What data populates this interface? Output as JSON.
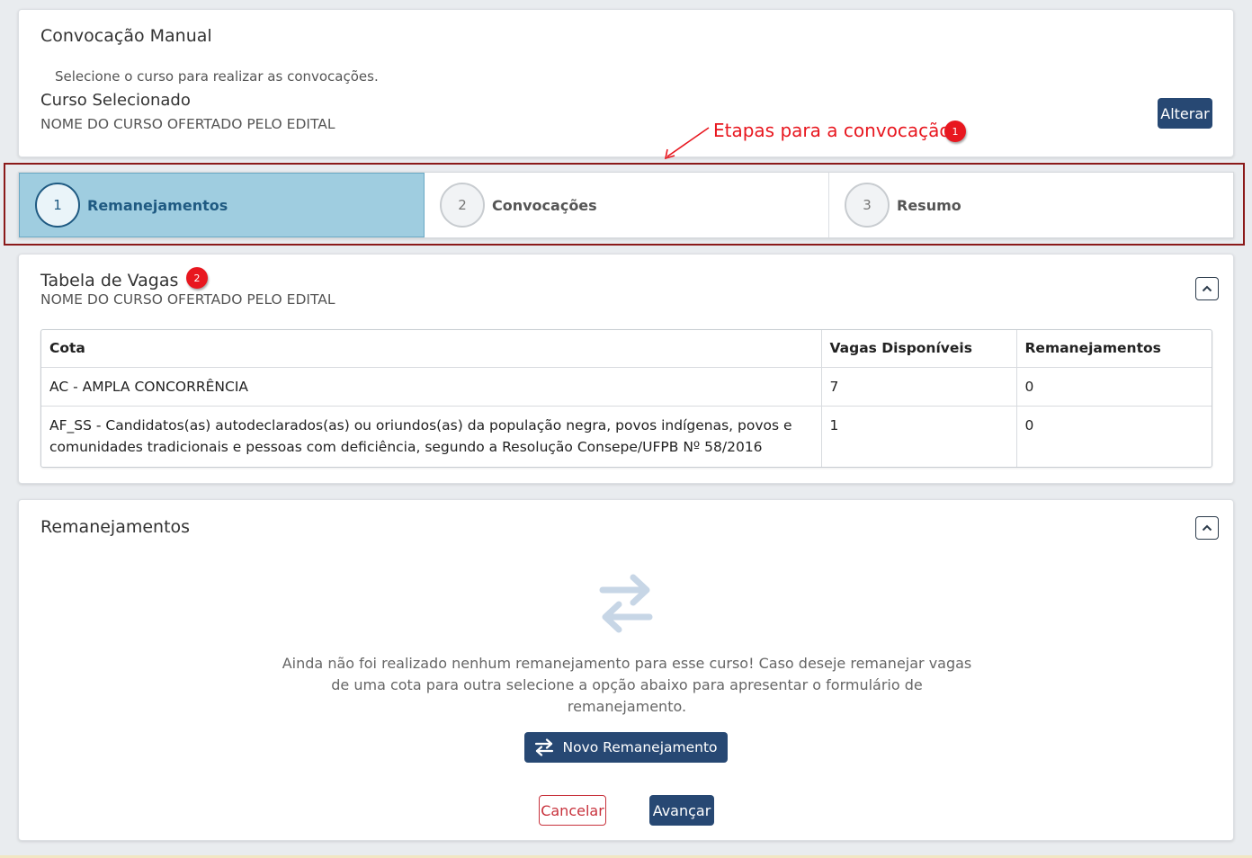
{
  "header": {
    "title": "Convocação Manual",
    "instruction": "Selecione o curso para realizar as convocações.",
    "course_label": "Curso Selecionado",
    "course_name": "NOME DO CURSO OFERTADO PELO EDITAL",
    "change_button": "Alterar"
  },
  "annotations": {
    "steps_note": "Etapas para a convocação",
    "badge1": "1",
    "badge2": "2"
  },
  "stepper": {
    "steps": [
      {
        "number": "1",
        "label": "Remanejamentos",
        "active": true
      },
      {
        "number": "2",
        "label": "Convocações",
        "active": false
      },
      {
        "number": "3",
        "label": "Resumo",
        "active": false
      }
    ]
  },
  "vagas": {
    "title": "Tabela de Vagas",
    "course_name": "NOME DO CURSO OFERTADO PELO EDITAL",
    "columns": [
      "Cota",
      "Vagas Disponíveis",
      "Remanejamentos"
    ],
    "rows": [
      {
        "cota": "AC - AMPLA CONCORRÊNCIA",
        "vagas": "7",
        "remanejamentos": "0"
      },
      {
        "cota": "AF_SS - Candidatos(as) autodeclarados(as) ou oriundos(as) da população negra, povos indígenas, povos e comunidades tradicionais e pessoas com deficiência, segundo a Resolução Consepe/UFPB Nº 58/2016",
        "vagas": "1",
        "remanejamentos": "0"
      }
    ]
  },
  "remanejamentos": {
    "title": "Remanejamentos",
    "empty_message": "Ainda não foi realizado nenhum remanejamento para esse curso! Caso deseje remanejar vagas de uma cota para outra selecione a opção abaixo para apresentar o formulário de remanejamento.",
    "new_button": "Novo Remanejamento",
    "cancel_button": "Cancelar",
    "next_button": "Avançar"
  },
  "colors": {
    "primary": "#274873",
    "step_active_bg": "#9fcde0",
    "annotation_red": "#e8171f",
    "cancel_red": "#c8323c",
    "outline_red": "#8b1a1a"
  },
  "icons": [
    "swap-arrows-icon",
    "chevron-up-icon",
    "annotation-arrow-icon"
  ]
}
